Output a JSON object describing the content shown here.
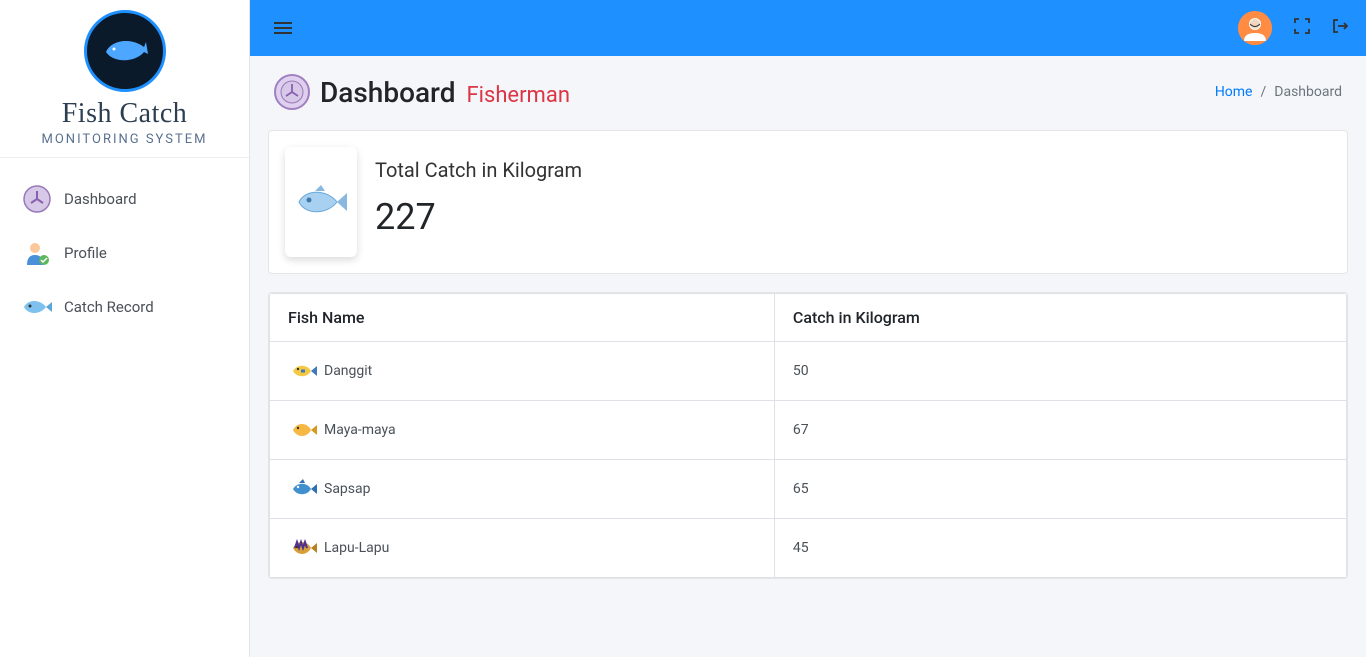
{
  "brand": {
    "title": "Fish Catch",
    "subtitle": "Monitoring System"
  },
  "sidebar": {
    "items": [
      {
        "label": "Dashboard"
      },
      {
        "label": "Profile"
      },
      {
        "label": "Catch Record"
      }
    ]
  },
  "header": {
    "title": "Dashboard",
    "subtitle": "Fisherman",
    "breadcrumb_home": "Home",
    "breadcrumb_current": "Dashboard"
  },
  "stat": {
    "label": "Total Catch in Kilogram",
    "value": "227"
  },
  "table": {
    "columns": [
      "Fish Name",
      "Catch in Kilogram"
    ],
    "rows": [
      {
        "name": "Danggit",
        "kg": "50"
      },
      {
        "name": "Maya-maya",
        "kg": "67"
      },
      {
        "name": "Sapsap",
        "kg": "65"
      },
      {
        "name": "Lapu-Lapu",
        "kg": "45"
      }
    ]
  }
}
